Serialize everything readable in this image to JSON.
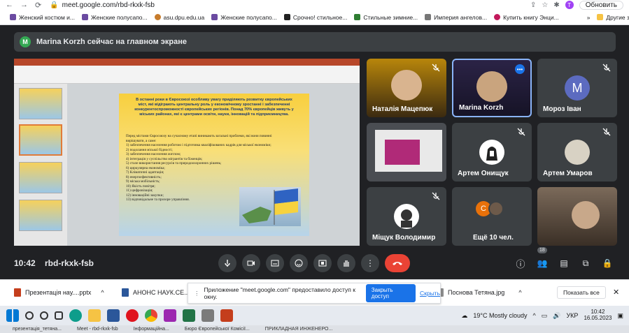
{
  "browser": {
    "url": "meet.google.com/rbd-rkxk-fsb",
    "profile_initial": "T",
    "update_button": "Обновить"
  },
  "bookmarks": {
    "items": [
      {
        "label": "Женский костюм и..."
      },
      {
        "label": "Женские полусапо..."
      },
      {
        "label": "asu.dpu.edu.ua"
      },
      {
        "label": "Женские полусапо..."
      },
      {
        "label": "Срочно! стильное..."
      },
      {
        "label": "Стильные зимние..."
      },
      {
        "label": "Империя ангелов..."
      },
      {
        "label": "Купить книгу Энци..."
      }
    ],
    "more": "»",
    "other": "Другие закладки"
  },
  "meet": {
    "banner": {
      "initial": "M",
      "text": "Marina Korzh сейчас на главном экране"
    },
    "time": "10:42",
    "code": "rbd-rkxk-fsb",
    "participants_badge": "18",
    "tiles": [
      {
        "name": "Наталія Мацепюк"
      },
      {
        "name": "Marina Korzh"
      },
      {
        "name": "Мороз Іван",
        "initial": "М"
      },
      {
        "name": ""
      },
      {
        "name": "Артем Онищук"
      },
      {
        "name": "Артем Умаров"
      },
      {
        "name": "Міщук Володимир"
      },
      {
        "name": "Ещё 10 чел.",
        "initial": "C"
      },
      {
        "name": ""
      }
    ],
    "slide": {
      "title": "В останні роки в Євросоюзі особливу увагу приділяють розвитку європейських міст, які відіграють центральну роль у економічному зростанні і забезпеченні конкурентоспроможності європейських регіонів. Понад 70% європейців живуть у міських районах, які є центрами освіти, науки, інновацій та підприємництва.",
      "intro": "Перед містами Євросоюзу на сучасному етапі виникають загальні проблеми, які вони повинні вирішувати, а саме:",
      "items": [
        "1) забезпечення населення роботою і підготовка кваліфікованих кадрів для міської економіки;",
        "2) подолання міської бідності;",
        "3) забезпечення населення житлом;",
        "4) інтеграція у суспільство мігрантів та біженців;",
        "5) сталe використання ресурсів та природоохоронних рішень;",
        "6) циркулярна економіка;",
        "7) Кліматичні адаптація;",
        "8) енергоефективність;",
        "9) міська мобільність;",
        "10) Якість повітря;",
        "11) цифровізація;",
        "12) інноваційні закупки;",
        "13) відповідальне та прозоре управління."
      ]
    }
  },
  "downloads": {
    "items": [
      {
        "label": "Презентація нау....pptx"
      },
      {
        "label": "АНОНС НАУК.СЕ....docx"
      },
      {
        "label": "Поснова Тетяна.jpg"
      }
    ],
    "access_text": "Приложение \"meet.google.com\" предоставило доступ к окну.",
    "access_button": "Закрыть доступ",
    "hide_link": "Скрыть",
    "show_all": "Показать все"
  },
  "taskbar": {
    "weather": "19°C  Mostly cloudy",
    "lang": "УКР",
    "time": "10:42",
    "date": "16.05.2023"
  },
  "tabstrip": {
    "items": [
      {
        "label": "презентація_тетяна..."
      },
      {
        "label": "Meet - rbd-rkxk-fsb"
      },
      {
        "label": "Інформаційна..."
      },
      {
        "label": "Бюро Європейської Комісії..."
      },
      {
        "label": "ПРИКЛАДНАЯ ИНЖЕНЕРО..."
      }
    ]
  }
}
